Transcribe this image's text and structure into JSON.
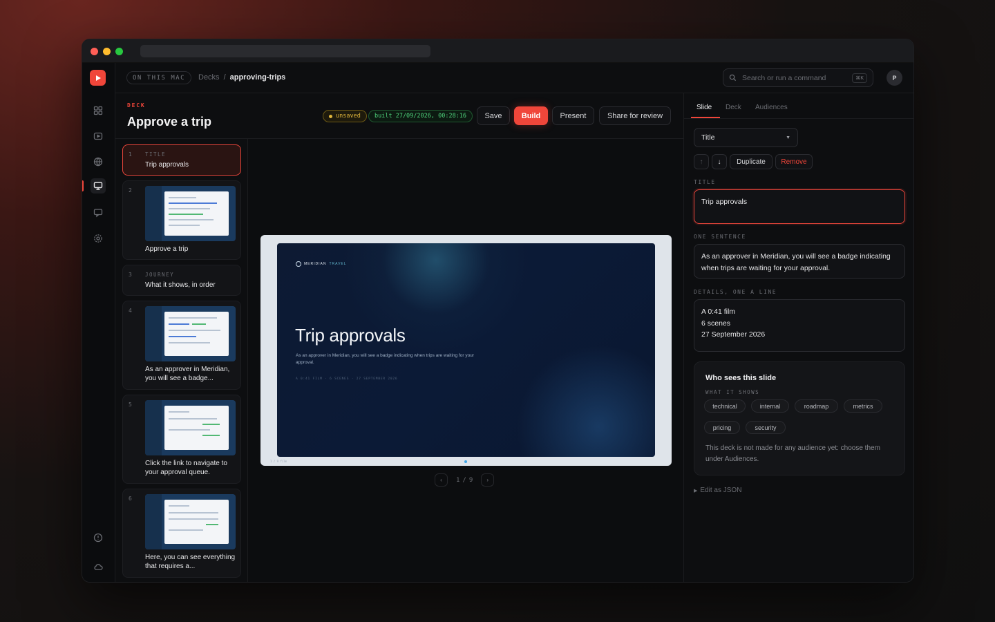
{
  "topbar": {
    "location_pill": "ON THIS MAC",
    "breadcrumb": [
      "Decks",
      "/",
      "approving-trips"
    ],
    "search_placeholder": "Search or run a command",
    "search_shortcut": "⌘K",
    "avatar_initial": "P"
  },
  "deck": {
    "label": "DECK",
    "title": "Approve a trip",
    "status_unsaved": "unsaved",
    "status_built": "built 27/09/2026, 00:28:16",
    "buttons": {
      "save": "Save",
      "build": "Build",
      "present": "Present",
      "share": "Share for review"
    }
  },
  "slides": [
    {
      "num": "1",
      "kind": "TITLE",
      "title": "Trip approvals"
    },
    {
      "num": "2",
      "kind": "",
      "title": "Approve a trip"
    },
    {
      "num": "3",
      "kind": "JOURNEY",
      "title": "What it shows, in order"
    },
    {
      "num": "4",
      "kind": "",
      "title": "As an approver in Meridian, you will see a badge..."
    },
    {
      "num": "5",
      "kind": "",
      "title": "Click the link to navigate to your approval queue."
    },
    {
      "num": "6",
      "kind": "",
      "title": "Here, you can see everything that requires a..."
    }
  ],
  "preview": {
    "brand": "MERIDIAN",
    "brand_accent": "TRAVEL",
    "title": "Trip approvals",
    "subtitle": "As an approver in Meridian, you will see a badge indicating when trips are waiting for your approval.",
    "meta": "A 0:41 FILM  ·  6 SCENES  ·  27 SEPTEMBER 2026",
    "footer": "1 / 9 film",
    "page_current": "1",
    "page_sep": "/",
    "page_total": "9"
  },
  "inspector": {
    "tabs": [
      "Slide",
      "Deck",
      "Audiences"
    ],
    "layout_select": "Title",
    "buttons": {
      "duplicate": "Duplicate",
      "remove": "Remove"
    },
    "title_label": "TITLE",
    "title_value": "Trip approvals",
    "sentence_label": "ONE SENTENCE",
    "sentence_value": "As an approver in Meridian, you will see a badge indicating when trips are waiting for your approval.",
    "details_label": "DETAILS, ONE A LINE",
    "details": [
      "A 0:41 film",
      "6 scenes",
      "27 September 2026"
    ],
    "audience_card": {
      "heading": "Who sees this slide",
      "sub": "WHAT IT SHOWS",
      "chips": [
        "technical",
        "internal",
        "roadmap",
        "metrics",
        "pricing",
        "security"
      ],
      "note": "This deck is not made for any audience yet: choose them under Audiences."
    },
    "json_link": "Edit as JSON"
  },
  "colors": {
    "accent": "#f0463a",
    "warning": "#e0b63c",
    "success": "#4fd37c"
  }
}
